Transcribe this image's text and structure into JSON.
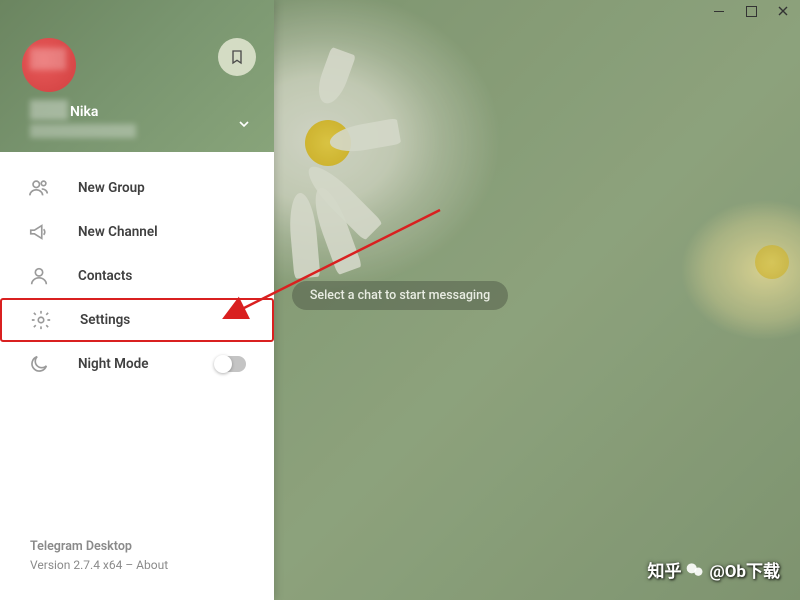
{
  "window": {
    "buttons": [
      "minimize",
      "maximize",
      "close"
    ]
  },
  "profile": {
    "name": "Nika"
  },
  "menu": {
    "items": [
      {
        "id": "new-group",
        "label": "New Group"
      },
      {
        "id": "new-channel",
        "label": "New Channel"
      },
      {
        "id": "contacts",
        "label": "Contacts"
      },
      {
        "id": "settings",
        "label": "Settings"
      },
      {
        "id": "night-mode",
        "label": "Night Mode",
        "toggle": false
      }
    ]
  },
  "highlight": {
    "item": "settings",
    "arrow_color": "#d92020"
  },
  "main": {
    "placeholder": "Select a chat to start messaging"
  },
  "footer": {
    "app_name": "Telegram Desktop",
    "version_line": "Version 2.7.4 x64 – About"
  },
  "watermark": {
    "text_left": "知乎",
    "text_right": "@Ob下载"
  }
}
